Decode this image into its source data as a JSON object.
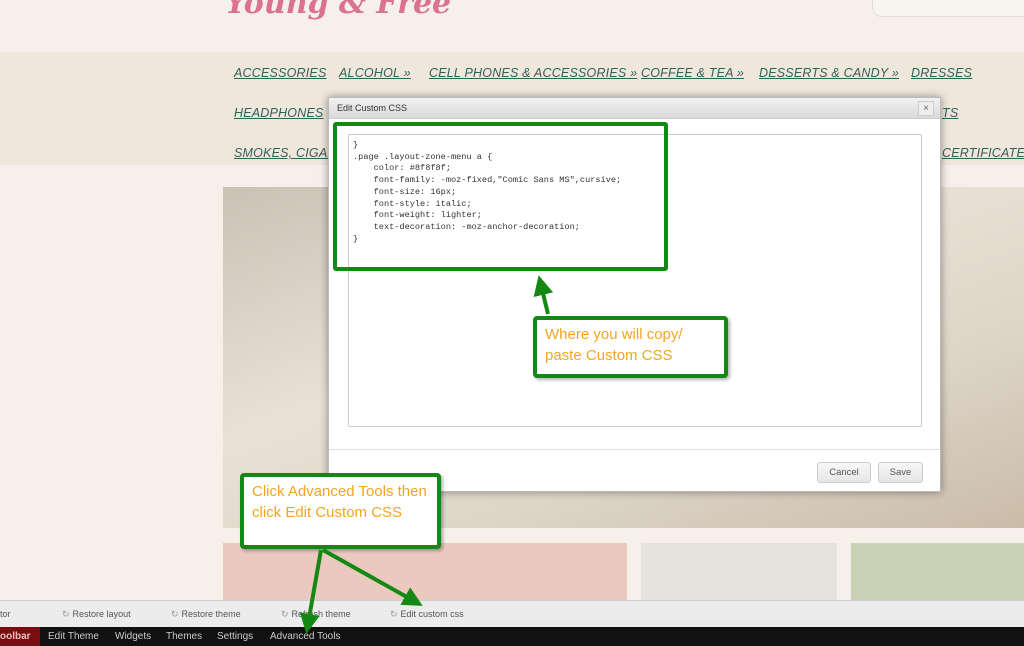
{
  "site": {
    "logo": "Young & Free"
  },
  "nav": {
    "row1": [
      "ACCESSORIES",
      "ALCOHOL »",
      "CELL PHONES & ACCESSORIES »",
      "COFFEE & TEA »",
      "DESSERTS & CANDY »",
      "DRESSES"
    ],
    "row2": [
      "HEADPHONES",
      "TS"
    ],
    "row3": [
      "SMOKES, CIGAR",
      "CERTIFICATES"
    ]
  },
  "toolbar": {
    "actions": [
      "tor",
      "Restore layout",
      "Restore theme",
      "Refresh theme",
      "Edit custom css"
    ],
    "tabs": [
      "oolbar",
      "Edit Theme",
      "Widgets",
      "Themes",
      "Settings",
      "Advanced Tools"
    ]
  },
  "dialog": {
    "title": "Edit Custom CSS",
    "close": "×",
    "css": "}\n.page .layout-zone-menu a {\n    color: #8f8f8f;\n    font-family: -moz-fixed,\"Comic Sans MS\",cursive;\n    font-size: 16px;\n    font-style: italic;\n    font-weight: lighter;\n    text-decoration: -moz-anchor-decoration;\n}",
    "cancel": "Cancel",
    "save": "Save"
  },
  "annotations": {
    "paste": "Where you will copy/ paste Custom CSS",
    "click": "Click Advanced Tools then click Edit Custom CSS"
  },
  "colors": {
    "annotation_green": "#148814",
    "annotation_text": "#f3a520",
    "toolbar_active": "#7a0d0d"
  }
}
